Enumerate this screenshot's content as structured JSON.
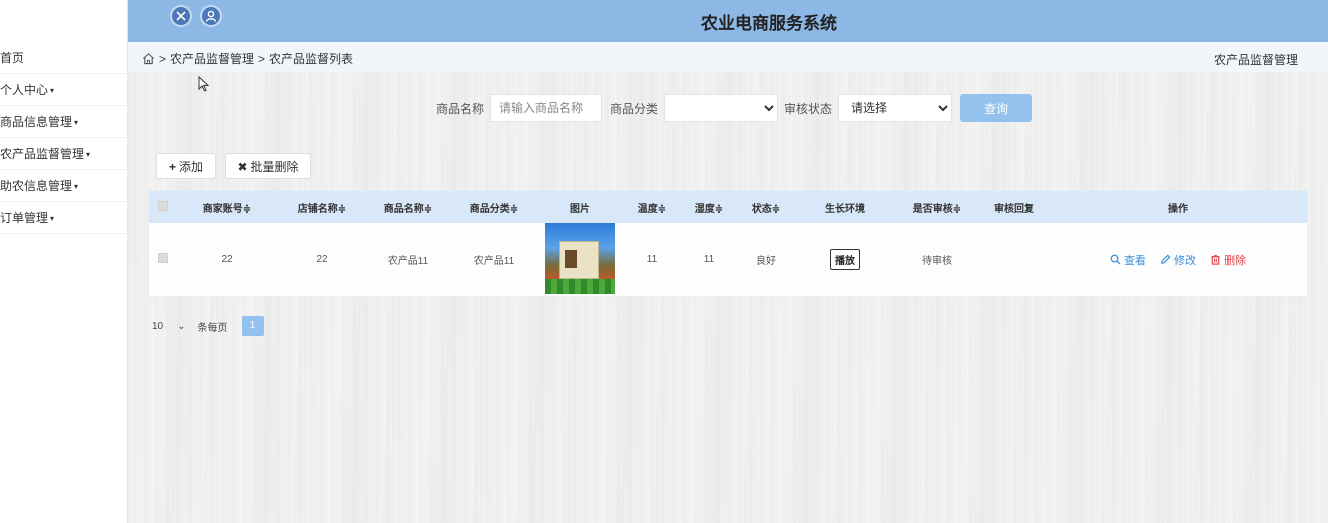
{
  "app": {
    "title": "农业电商服务系统"
  },
  "sidebar": {
    "items": [
      {
        "label": "首页",
        "caret": ""
      },
      {
        "label": "个人中心",
        "caret": "▾"
      },
      {
        "label": "商品信息管理",
        "caret": "▾"
      },
      {
        "label": "农产品监督管理",
        "caret": "▾"
      },
      {
        "label": "助农信息管理",
        "caret": "▾"
      },
      {
        "label": "订单管理",
        "caret": "▾"
      }
    ]
  },
  "breadcrumb": {
    "sep": ">",
    "level1": "农产品监督管理",
    "level2": "农产品监督列表",
    "right_title": "农产品监督管理"
  },
  "search": {
    "name_label": "商品名称",
    "name_placeholder": "请输入商品名称",
    "category_label": "商品分类",
    "category_value": "",
    "status_label": "审核状态",
    "status_value": "请选择",
    "query_button": "查询"
  },
  "toolbar": {
    "add_label": "添加",
    "batch_delete_label": "批量删除"
  },
  "table": {
    "headers": [
      "商家账号",
      "店铺名称",
      "商品名称",
      "商品分类",
      "图片",
      "温度",
      "湿度",
      "状态",
      "生长环境",
      "是否审核",
      "审核回复",
      "操作"
    ],
    "sort_mark": "≑",
    "row": {
      "merchant": "22",
      "shop": "22",
      "product": "农产品11",
      "category": "农产品11",
      "temperature": "11",
      "humidity": "11",
      "status": "良好",
      "env_button": "播放",
      "audit": "待审核",
      "audit_reply": "",
      "view": "查看",
      "edit": "修改",
      "delete": "删除"
    }
  },
  "pager": {
    "page_size": "10",
    "per_page_label": "条每页",
    "current_page": "1"
  },
  "colors": {
    "header_bg": "#8db8e6",
    "table_head_bg": "#d9e8f8",
    "accent": "#93c2ef",
    "danger": "#e0454b"
  }
}
